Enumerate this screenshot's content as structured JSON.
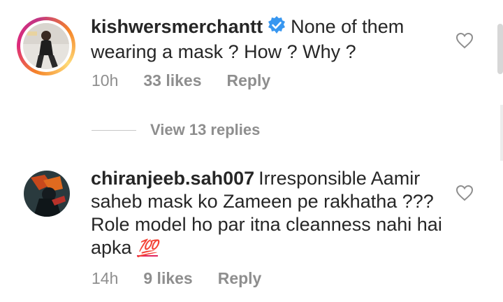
{
  "comments": [
    {
      "username": "kishwersmerchantt",
      "verified": true,
      "text": "None of them wearing a mask ? How ? Why ?",
      "time": "10h",
      "likes": "33 likes",
      "reply_label": "Reply",
      "view_replies": "View 13 replies"
    },
    {
      "username": "chiranjeeb.sah007",
      "verified": false,
      "text": "Irresponsible Aamir saheb mask ko Zameen pe rakhatha ??? Role model ho par itna cleanness nahi hai apka",
      "emoji": "💯",
      "time": "14h",
      "likes": "9 likes",
      "reply_label": "Reply"
    }
  ],
  "icons": {
    "verified": "verified-badge-icon",
    "like": "heart-outline-icon"
  },
  "colors": {
    "text": "#262626",
    "muted": "#8e8e8e",
    "verified_blue": "#3897f0",
    "story_ring_start": "#f58529",
    "story_ring_end": "#dd2a7b"
  }
}
